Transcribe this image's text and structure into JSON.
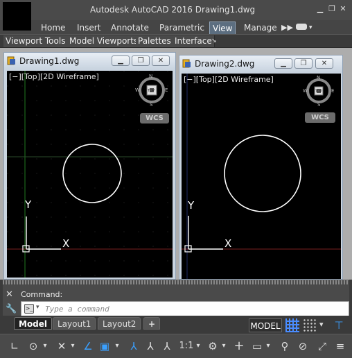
{
  "titlebar": {
    "title": "Autodesk AutoCAD 2016    Drawing1.dwg",
    "minimize_icon": "minimize-icon",
    "restore_icon": "restore-icon",
    "close_icon": "close-icon"
  },
  "ribbon": {
    "tabs": [
      {
        "label": "Home"
      },
      {
        "label": "Insert"
      },
      {
        "label": "Annotate"
      },
      {
        "label": "Parametric"
      },
      {
        "label": "View",
        "active": true
      },
      {
        "label": "Manage"
      }
    ],
    "overflow_icon": "double-chevron-right-icon",
    "panels": [
      {
        "label": "Viewport Tools"
      },
      {
        "label": "Model Viewports"
      },
      {
        "label": "Palettes"
      },
      {
        "label": "Interface"
      }
    ]
  },
  "windows": [
    {
      "title": "Drawing1.dwg",
      "viewport_label": "[−][Top][2D Wireframe]",
      "viewcube": {
        "n": "N",
        "s": "S",
        "e": "E",
        "w": "W",
        "top": "TOP"
      },
      "wcs": "WCS",
      "ucs_x": "X",
      "ucs_y": "Y"
    },
    {
      "title": "Drawing2.dwg",
      "viewport_label": "[−][Top][2D Wireframe]",
      "viewcube": {
        "n": "N",
        "s": "S",
        "e": "E",
        "w": "W",
        "top": "TOP"
      },
      "wcs": "WCS",
      "ucs_x": "X",
      "ucs_y": "Y"
    }
  ],
  "command": {
    "label": "Command:",
    "placeholder": "Type a command"
  },
  "layout_tabs": [
    {
      "label": "Model",
      "active": true
    },
    {
      "label": "Layout1"
    },
    {
      "label": "Layout2"
    }
  ],
  "add_layout": "+",
  "status": {
    "model_label": "MODEL",
    "scale": "1:1"
  },
  "colors": {
    "canvas": "#000000",
    "ribbon_active_tab": "#5c6e80",
    "wcs_badge": "#666666",
    "green_axis": "#1f7a1f",
    "red_axis": "#7a1f1f"
  }
}
